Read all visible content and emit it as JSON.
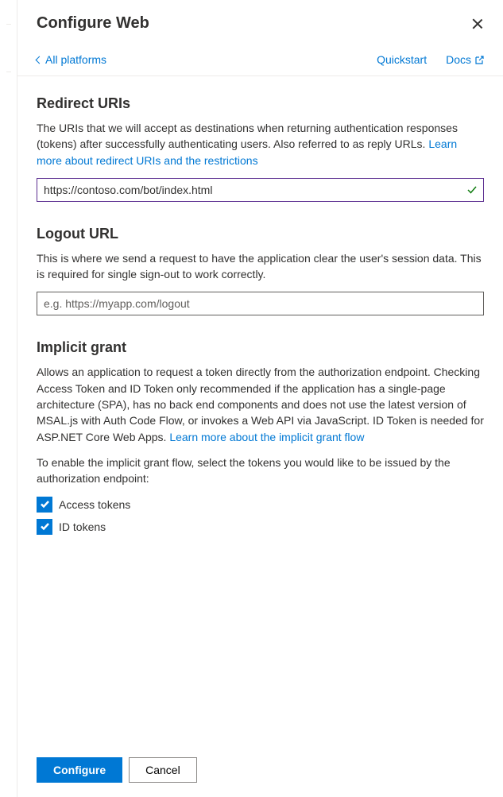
{
  "header": {
    "title": "Configure Web"
  },
  "topbar": {
    "back": "All platforms",
    "quickstart": "Quickstart",
    "docs": "Docs"
  },
  "redirect": {
    "heading": "Redirect URIs",
    "description": "The URIs that we will accept as destinations when returning authentication responses (tokens) after successfully authenticating users. Also referred to as reply URLs. ",
    "learn_more": "Learn more about redirect URIs and the restrictions",
    "value": "https://contoso.com/bot/index.html"
  },
  "logout": {
    "heading": "Logout URL",
    "description": "This is where we send a request to have the application clear the user's session data. This is required for single sign-out to work correctly.",
    "placeholder": "e.g. https://myapp.com/logout"
  },
  "implicit": {
    "heading": "Implicit grant",
    "description": "Allows an application to request a token directly from the authorization endpoint. Checking Access Token and ID Token only recommended if the application has a single-page architecture (SPA), has no back end components and does not use the latest version of MSAL.js with Auth Code Flow, or invokes a Web API via JavaScript. ID Token is needed for ASP.NET Core Web Apps. ",
    "learn_more": "Learn more about the implicit grant flow",
    "enable_text": "To enable the implicit grant flow, select the tokens you would like to be issued by the authorization endpoint:",
    "access_tokens": "Access tokens",
    "id_tokens": "ID tokens"
  },
  "footer": {
    "configure": "Configure",
    "cancel": "Cancel"
  }
}
